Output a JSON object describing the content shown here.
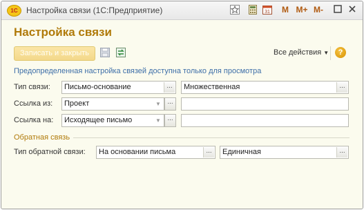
{
  "window": {
    "title": "Настройка связи (1С:Предприятие)",
    "logo_text": "1С",
    "toolbar": [
      "M",
      "M+",
      "M-"
    ]
  },
  "form": {
    "title": "Настройка связи",
    "save_close_label": "Записать и закрыть",
    "all_actions_label": "Все действия",
    "help_label": "?",
    "info_text": "Предопределенная настройка связей доступна только для просмотра"
  },
  "fields": {
    "link_type_label": "Тип связи:",
    "link_type_value": "Письмо-основание",
    "link_type_mult": "Множественная",
    "link_from_label": "Ссылка из:",
    "link_from_value": "Проект",
    "link_from_extra": "",
    "link_to_label": "Ссылка на:",
    "link_to_value": "Исходящее письмо",
    "link_to_extra": "",
    "back_group_title": "Обратная связь",
    "back_type_label": "Тип обратной связи:",
    "back_type_value": "На основании письма",
    "back_type_mult": "Единичная"
  },
  "colors": {
    "form_background": "#fbfbee",
    "accent": "#b07a09",
    "info": "#3d6ea8"
  }
}
